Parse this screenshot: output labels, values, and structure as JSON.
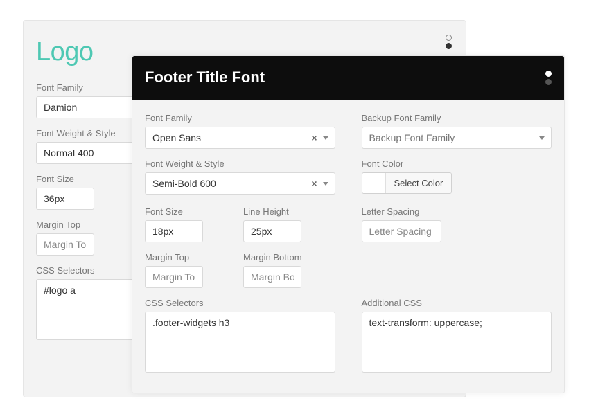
{
  "backPanel": {
    "title": "Logo",
    "labels": {
      "fontFamily": "Font Family",
      "fontWeightStyle": "Font Weight & Style",
      "fontSize": "Font Size",
      "marginTop": "Margin Top",
      "cssSelectors": "CSS Selectors"
    },
    "values": {
      "fontFamily": "Damion",
      "fontWeightStyle": "Normal 400",
      "fontSize": "36px",
      "cssSelectors": "#logo a"
    },
    "placeholders": {
      "marginTop": "Margin Top"
    }
  },
  "frontPanel": {
    "title": "Footer Title Font",
    "labels": {
      "fontFamily": "Font Family",
      "backupFontFamily": "Backup Font Family",
      "fontWeightStyle": "Font Weight & Style",
      "fontColor": "Font Color",
      "selectColor": "Select Color",
      "fontSize": "Font Size",
      "lineHeight": "Line Height",
      "letterSpacing": "Letter Spacing",
      "marginTop": "Margin Top",
      "marginBottom": "Margin Bottom",
      "cssSelectors": "CSS Selectors",
      "additionalCss": "Additional CSS"
    },
    "values": {
      "fontFamily": "Open Sans",
      "fontWeightStyle": "Semi-Bold 600",
      "fontSize": "18px",
      "lineHeight": "25px",
      "cssSelectors": ".footer-widgets h3",
      "additionalCss": "text-transform: uppercase;"
    },
    "placeholders": {
      "backupFontFamily": "Backup Font Family",
      "letterSpacing": "Letter Spacing",
      "marginTop": "Margin Top",
      "marginBottom": "Margin Bottom"
    }
  }
}
